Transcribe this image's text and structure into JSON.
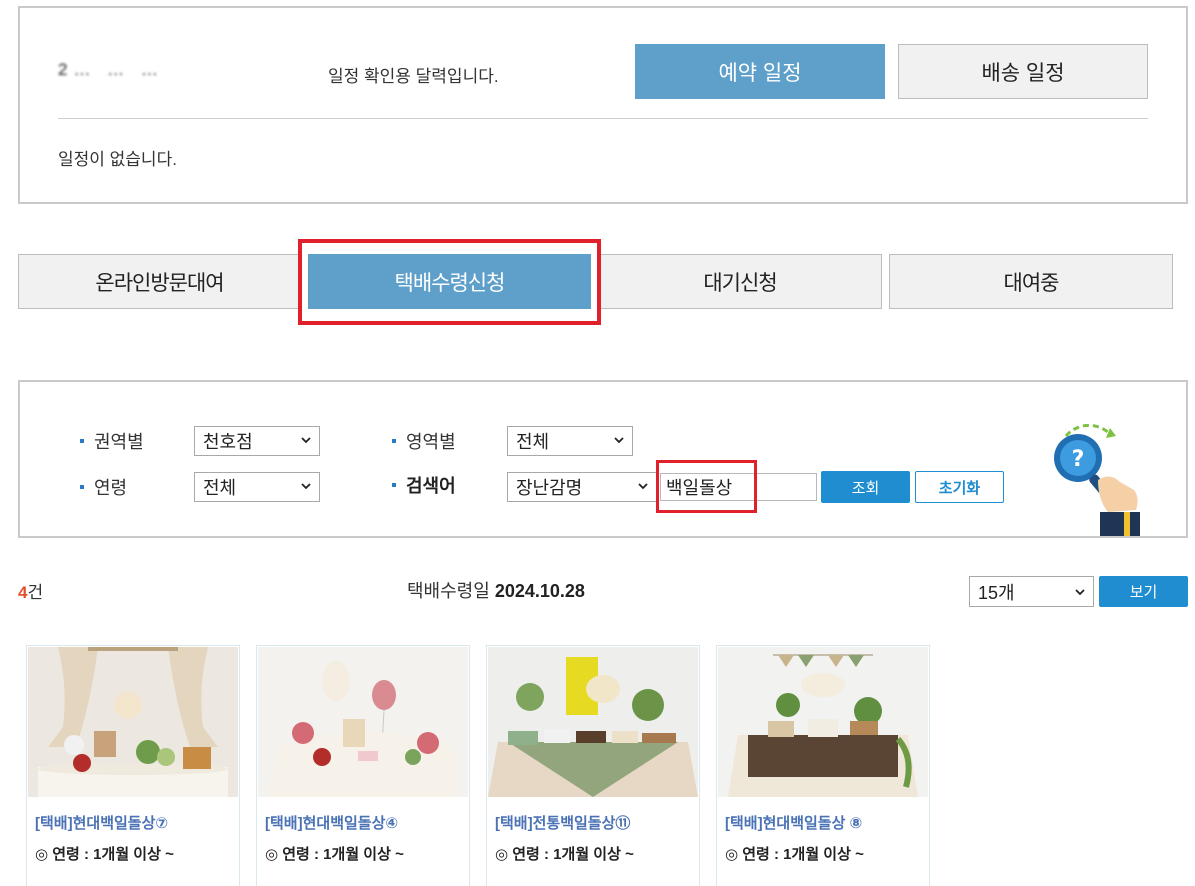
{
  "calendar": {
    "date_text": "2… … …",
    "description": "일정 확인용 달력입니다.",
    "reserve_button": "예약 일정",
    "delivery_button": "배송 일정",
    "empty_message": "일정이 없습니다."
  },
  "tabs": [
    {
      "label": "온라인방문대여",
      "active": false
    },
    {
      "label": "택배수령신청",
      "active": true
    },
    {
      "label": "대기신청",
      "active": false
    },
    {
      "label": "대여중",
      "active": false
    }
  ],
  "filters": {
    "region_label": "권역별",
    "region_value": "천호점",
    "area_label": "영역별",
    "area_value": "전체",
    "age_label": "연령",
    "age_value": "전체",
    "keyword_label": "검색어",
    "keyword_type_value": "장난감명",
    "keyword_value": "백일돌상",
    "search_button": "조회",
    "reset_button": "초기화"
  },
  "results": {
    "count_number": "4",
    "count_unit": "건",
    "date_label": "택배수령일",
    "date_value": "2024.10.28",
    "per_page_value": "15개",
    "view_button": "보기"
  },
  "products": [
    {
      "title": "[택배]현대백일돌상⑦",
      "age": "◎ 연령 : 1개월 이상 ~"
    },
    {
      "title": "[택배]현대백일돌상④",
      "age": "◎ 연령 : 1개월 이상 ~"
    },
    {
      "title": "[택배]전통백일돌상⑪",
      "age": "◎ 연령 : 1개월 이상 ~"
    },
    {
      "title": "[택배]현대백일돌상 ⑧",
      "age": "◎ 연령 : 1개월 이상 ~"
    }
  ],
  "colors": {
    "accent": "#5fa0cb",
    "button_blue": "#1f8dd0",
    "highlight_red": "#e0202a",
    "count_orange": "#e3502b",
    "product_title": "#4a72b5"
  },
  "icons": {
    "search_help": "magnifier-question-icon",
    "select_arrow": "chevron-down-icon"
  }
}
